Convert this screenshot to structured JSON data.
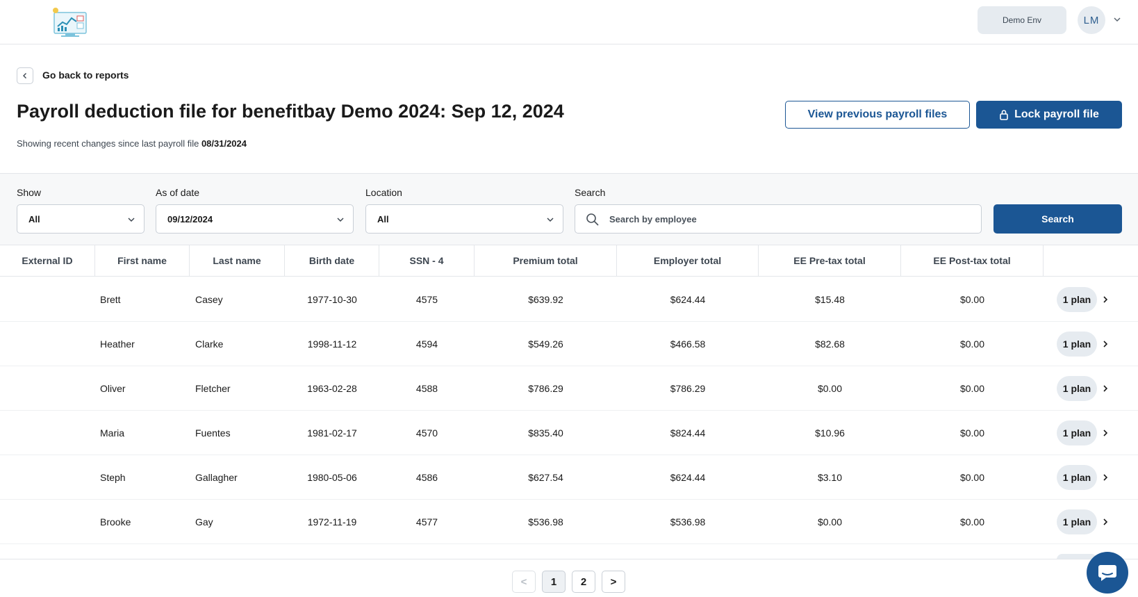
{
  "header": {
    "env_label": "Demo Env",
    "user_initials": "LM"
  },
  "nav": {
    "back_label": "Go back to reports"
  },
  "page": {
    "title": "Payroll deduction file for benefitbay Demo 2024: Sep 12, 2024",
    "subtitle_prefix": "Showing recent changes since last payroll file",
    "subtitle_date": "08/31/2024",
    "view_previous_label": "View previous payroll files",
    "lock_label": "Lock payroll file"
  },
  "filters": {
    "show": {
      "label": "Show",
      "value": "All"
    },
    "as_of_date": {
      "label": "As of date",
      "value": "09/12/2024"
    },
    "location": {
      "label": "Location",
      "value": "All"
    },
    "search": {
      "label": "Search",
      "placeholder": "Search by employee",
      "button": "Search"
    }
  },
  "table": {
    "columns": [
      "External ID",
      "First name",
      "Last name",
      "Birth date",
      "SSN - 4",
      "Premium total",
      "Employer total",
      "EE Pre-tax total",
      "EE Post-tax total"
    ],
    "rows": [
      {
        "external_id": "",
        "first": "Brett",
        "last": "Casey",
        "birth": "1977-10-30",
        "ssn4": "4575",
        "premium": "$639.92",
        "employer": "$624.44",
        "pretax": "$15.48",
        "posttax": "$0.00",
        "plans": "1 plan"
      },
      {
        "external_id": "",
        "first": "Heather",
        "last": "Clarke",
        "birth": "1998-11-12",
        "ssn4": "4594",
        "premium": "$549.26",
        "employer": "$466.58",
        "pretax": "$82.68",
        "posttax": "$0.00",
        "plans": "1 plan"
      },
      {
        "external_id": "",
        "first": "Oliver",
        "last": "Fletcher",
        "birth": "1963-02-28",
        "ssn4": "4588",
        "premium": "$786.29",
        "employer": "$786.29",
        "pretax": "$0.00",
        "posttax": "$0.00",
        "plans": "1 plan"
      },
      {
        "external_id": "",
        "first": "Maria",
        "last": "Fuentes",
        "birth": "1981-02-17",
        "ssn4": "4570",
        "premium": "$835.40",
        "employer": "$824.44",
        "pretax": "$10.96",
        "posttax": "$0.00",
        "plans": "1 plan"
      },
      {
        "external_id": "",
        "first": "Steph",
        "last": "Gallagher",
        "birth": "1980-05-06",
        "ssn4": "4586",
        "premium": "$627.54",
        "employer": "$624.44",
        "pretax": "$3.10",
        "posttax": "$0.00",
        "plans": "1 plan"
      },
      {
        "external_id": "",
        "first": "Brooke",
        "last": "Gay",
        "birth": "1972-11-19",
        "ssn4": "4577",
        "premium": "$536.98",
        "employer": "$536.98",
        "pretax": "$0.00",
        "posttax": "$0.00",
        "plans": "1 plan"
      }
    ]
  },
  "pagination": {
    "prev": "<",
    "pages": [
      "1",
      "2"
    ],
    "current": "1",
    "next": ">"
  },
  "icons": {
    "logo": "dashboard-monitor-icon",
    "back": "chevron-left-icon",
    "lock": "lock-icon",
    "dropdown": "chevron-down-icon",
    "search": "search-icon",
    "row_action": "chevron-right-icon",
    "chat": "chat-bubble-icon"
  },
  "colors": {
    "primary": "#1b5694",
    "surface_muted": "#e6ebf0",
    "filter_bg": "#f7f8f9",
    "border": "#c9cfd6"
  }
}
